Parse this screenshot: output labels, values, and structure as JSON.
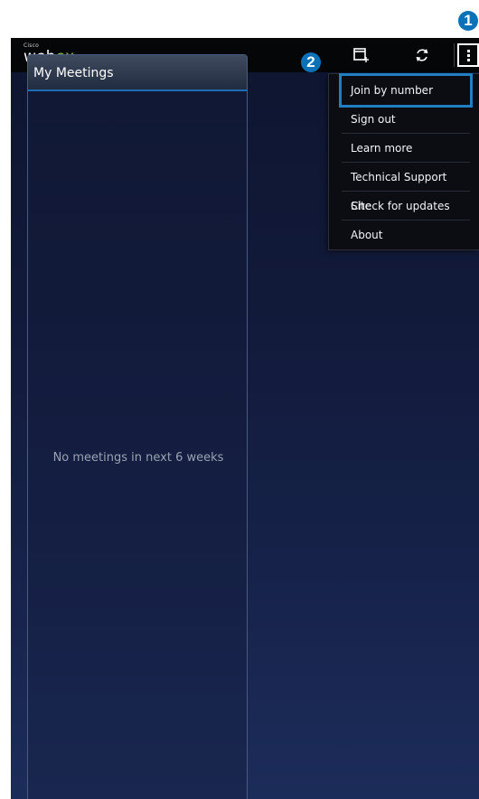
{
  "app": {
    "logo_small": "Cisco",
    "logo_main_prefix": "web",
    "logo_main_suffix": "ex"
  },
  "toolbar": {
    "icons": [
      "calendar-add-icon",
      "refresh-icon",
      "overflow-menu-icon"
    ]
  },
  "panel": {
    "title": "My Meetings",
    "empty_message": "No meetings in next 6 weeks"
  },
  "menu": {
    "items": [
      {
        "label": "Join by number",
        "highlighted": true
      },
      {
        "label": "Sign out"
      },
      {
        "label": "Learn more"
      },
      {
        "label": "Technical Support Site"
      },
      {
        "label": "Check for updates"
      },
      {
        "label": "About"
      }
    ]
  },
  "callouts": [
    "1",
    "2"
  ],
  "colors": {
    "callout": "#0c72b8",
    "accent_green": "#8ac43f",
    "header_accent": "#1c6fb5"
  }
}
